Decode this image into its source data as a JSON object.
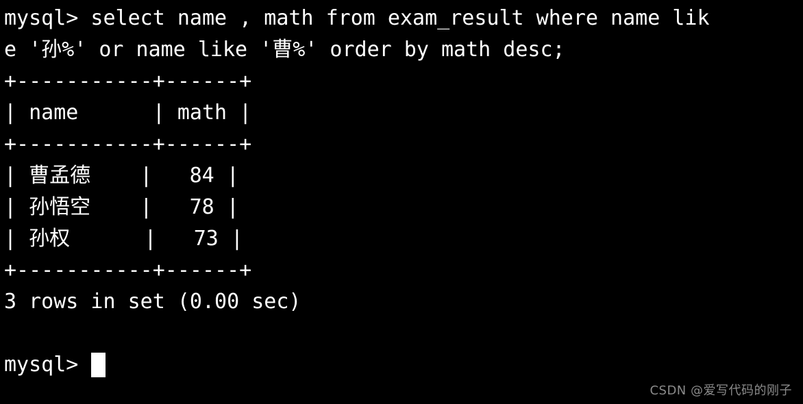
{
  "terminal": {
    "background_color": "#000000",
    "foreground_color": "#ffffff",
    "prompt": "mysql> ",
    "query_line_1": "mysql> select name , math from exam_result where name lik",
    "query_line_2": "e '孙%' or name like '曹%' order by math desc;",
    "sql_statement": "select name , math from exam_result where name like '孙%' or name like '曹%' order by math desc;",
    "border_line": "+-----------+------+",
    "header_line": "| name      | math |",
    "row_line_1": "| 曹孟德    |   84 |",
    "row_line_2": "| 孙悟空    |   78 |",
    "row_line_3": "| 孙权      |   73 |",
    "status_line": "3 rows in set (0.00 sec)",
    "blank_line": " ",
    "final_prompt": "mysql> ",
    "cursor": "block-cursor"
  },
  "result_table": {
    "columns": [
      "name",
      "math"
    ],
    "rows": [
      {
        "name": "曹孟德",
        "math": "84"
      },
      {
        "name": "孙悟空",
        "math": "78"
      },
      {
        "name": "孙权",
        "math": "73"
      }
    ],
    "row_count": "3 rows",
    "elapsed": "0.00 sec"
  },
  "watermark": {
    "text": "CSDN @爱写代码的刚子",
    "color": "#8a8a8a"
  }
}
